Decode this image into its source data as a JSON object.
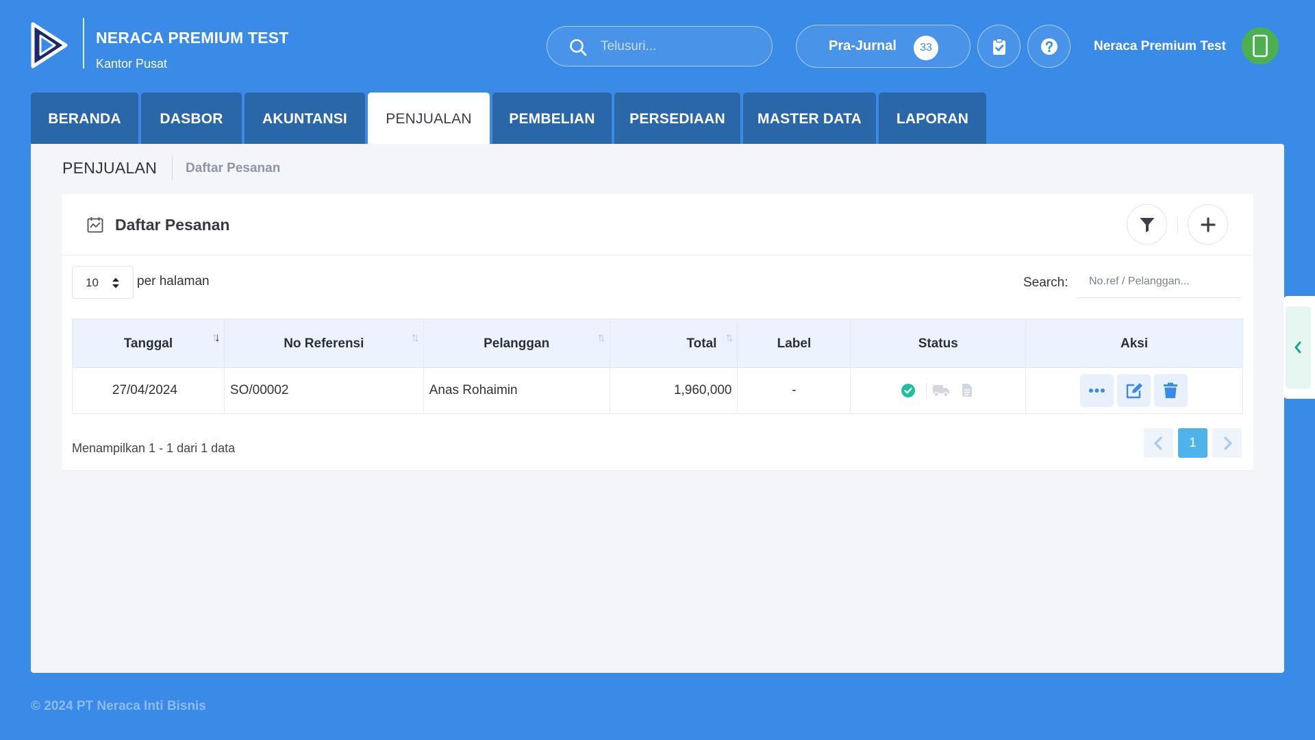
{
  "header": {
    "company_name": "NERACA PREMIUM TEST",
    "branch_name": "Kantor Pusat",
    "search_placeholder": "Telusuri...",
    "prajurnal_label": "Pra-Jurnal",
    "prajurnal_count": "33",
    "user_name": "Neraca Premium Test",
    "icons": [
      "logo",
      "search-icon",
      "clipboard-check-icon",
      "help-icon",
      "mobile-phone-icon"
    ]
  },
  "tabs": [
    {
      "label": "BERANDA",
      "active": false
    },
    {
      "label": "DASBOR",
      "active": false
    },
    {
      "label": "AKUNTANSI",
      "active": false
    },
    {
      "label": "PENJUALAN",
      "active": true
    },
    {
      "label": "PEMBELIAN",
      "active": false
    },
    {
      "label": "PERSEDIAAN",
      "active": false
    },
    {
      "label": "MASTER DATA",
      "active": false
    },
    {
      "label": "LAPORAN",
      "active": false
    }
  ],
  "breadcrumb": {
    "section": "PENJUALAN",
    "page": "Daftar Pesanan"
  },
  "card": {
    "title": "Daftar Pesanan",
    "per_page_value": "10",
    "per_page_label": "per halaman",
    "search_label": "Search:",
    "search_placeholder": "No.ref / Pelanggan...",
    "columns": [
      "Tanggal",
      "No Referensi",
      "Pelanggan",
      "Total",
      "Label",
      "Status",
      "Aksi"
    ],
    "rows": [
      {
        "tanggal": "27/04/2024",
        "no_referensi": "SO/00002",
        "pelanggan": "Anas Rohaimin",
        "total": "1,960,000",
        "label": "-",
        "status": [
          "check-circle-icon",
          "truck-icon",
          "invoice-icon"
        ]
      }
    ],
    "footer_info": "Menampilkan 1 - 1 dari 1 data",
    "current_page": "1"
  },
  "copyright": "© 2024 PT Neraca Inti Bisnis",
  "colors": {
    "background": "#3a8be8",
    "tab": "#2a67a9",
    "table_header": "#edf2ff",
    "success": "#1fbf9f",
    "action": "#3a8be8",
    "page_active": "#4db3ea"
  }
}
